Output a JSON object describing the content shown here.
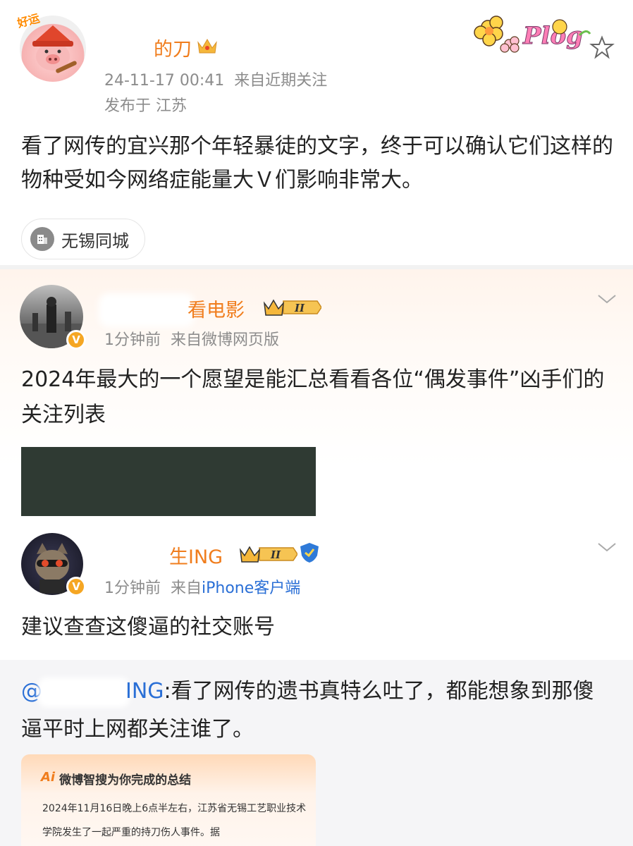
{
  "post": {
    "username_visible": "的刀",
    "timestamp": "24-11-17 00:41",
    "source": "来自近期关注",
    "location": "发布于 江苏",
    "text": "看了网传的宜兴那个年轻暴徒的文字，终于可以确认它们这样的物种受如今网络症能量大Ｖ们影响非常大。",
    "topic_tag": "无锡同城",
    "sticker_text": "Plog",
    "avatar_badge_text": "好运"
  },
  "comments": [
    {
      "username_visible": "看电影",
      "vip_level": "II",
      "time": "1分钟前",
      "source": "来自微博网页版",
      "text": "2024年最大的一个愿望是能汇总看看各位“偶发事件”凶手们的关注列表"
    },
    {
      "username_visible": "生ING",
      "vip_level": "II",
      "time": "1分钟前",
      "source_prefix": "来自",
      "source_link": "iPhone客户端",
      "text": "建议查查这傻逼的社交账号"
    }
  ],
  "repost": {
    "mention_prefix": "@",
    "mention_visible": "ING",
    "text": ":看了网传的遗书真特么吐了，都能想象到那傻逼平时上网都关注谁了。"
  },
  "ai_card": {
    "logo": "Ai",
    "title": "微博智搜为你完成的总结",
    "body": "2024年11月16日晚上6点半左右，江苏省无锡工艺职业技术学院发生了一起严重的持刀伤人事件。据"
  },
  "badges": {
    "verified": "V"
  },
  "colors": {
    "name_orange": "#f07d1d",
    "link_blue": "#2a6fd6",
    "meta_gray": "#8c8c8c",
    "verified_badge": "#f5a623"
  }
}
